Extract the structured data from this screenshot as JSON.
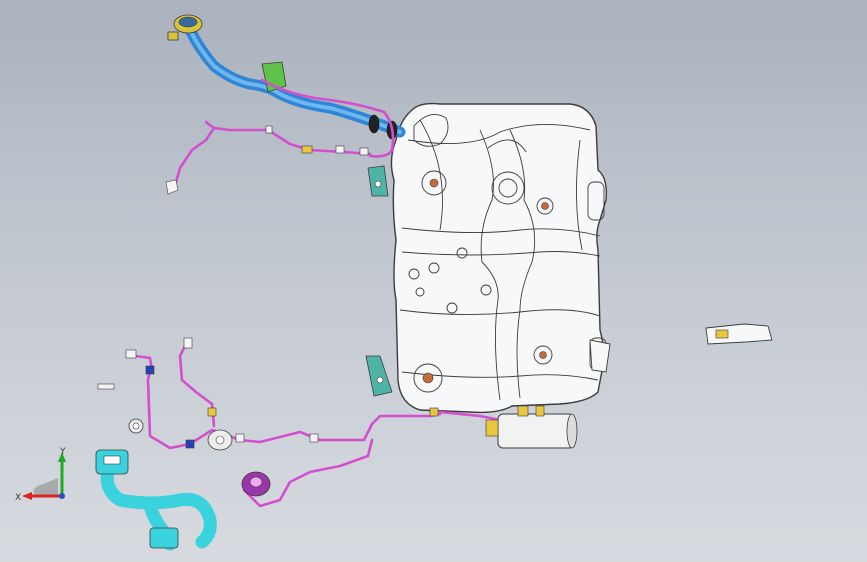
{
  "viewport": {
    "background_top": "#a9b2bd",
    "background_bottom": "#d7dbe0"
  },
  "colors": {
    "tank_fill": "#f7f8fa",
    "tank_edge": "#3c3c3c",
    "fill_pipe": "#2f86d6",
    "fill_pipe_light": "#6fb8ef",
    "vent_hose": "#d44fd0",
    "filler_neck": "#d6c43a",
    "bracket_green": "#5fc24a",
    "hose_cyan": "#3ad2dc",
    "connector_purple": "#9a37a8",
    "boss_orange": "#c56a3a",
    "bracket_teal": "#4fb4a8",
    "axis_x": "#d22",
    "axis_y": "#2a2",
    "axis_z": "#25c"
  },
  "triad": {
    "x_label": "X",
    "y_label": "Y"
  },
  "icons": {
    "triad": "coordinate-triad-icon"
  }
}
